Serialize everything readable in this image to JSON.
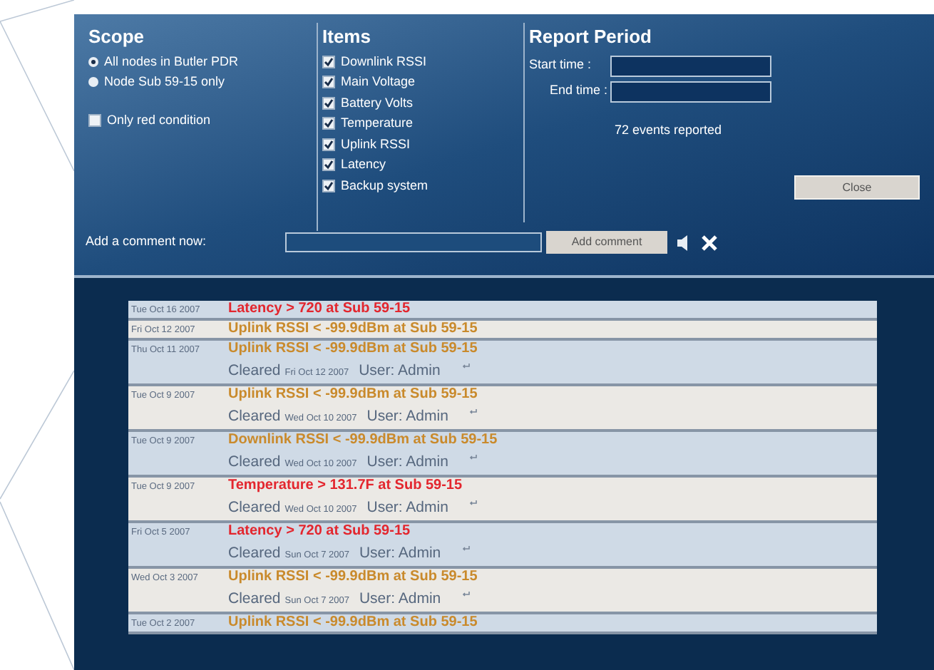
{
  "scope": {
    "title": "Scope",
    "options": [
      {
        "label": "All nodes in Butler PDR",
        "selected": true
      },
      {
        "label": "Node Sub 59-15 only",
        "selected": false
      }
    ],
    "filter": {
      "label": "Only red condition",
      "checked": false
    }
  },
  "items": {
    "title": "Items",
    "options": [
      {
        "label": "Downlink RSSI",
        "checked": true
      },
      {
        "label": "Main Voltage",
        "checked": true
      },
      {
        "label": "Battery Volts",
        "checked": true
      },
      {
        "label": "Temperature",
        "checked": true
      },
      {
        "label": "Uplink RSSI",
        "checked": true
      },
      {
        "label": "Latency",
        "checked": true
      },
      {
        "label": "Backup system",
        "checked": true
      }
    ]
  },
  "report_period": {
    "title": "Report Period",
    "start_label": "Start time :",
    "end_label": "End time :",
    "summary": "72 events reported"
  },
  "close_button": "Close",
  "comment": {
    "label": "Add a comment now:",
    "button": "Add comment"
  },
  "events": [
    {
      "date": "Tue Oct 16 2007",
      "message": "Latency > 720 at Sub 59-15",
      "kind": "red"
    },
    {
      "date": "Fri Oct 12 2007",
      "message": "Uplink RSSI < -99.9dBm at Sub 59-15",
      "kind": "orange"
    },
    {
      "date": "Thu Oct 11 2007",
      "message": "Uplink RSSI < -99.9dBm at Sub 59-15",
      "kind": "orange",
      "cleared": {
        "label": "Cleared",
        "date": "Fri Oct 12 2007",
        "user": "User: Admin"
      }
    },
    {
      "date": "Tue Oct 9 2007",
      "message": "Uplink RSSI < -99.9dBm at Sub 59-15",
      "kind": "orange",
      "cleared": {
        "label": "Cleared",
        "date": "Wed Oct 10 2007",
        "user": "User: Admin"
      }
    },
    {
      "date": "Tue Oct 9 2007",
      "message": "Downlink RSSI < -99.9dBm at Sub 59-15",
      "kind": "orange",
      "cleared": {
        "label": "Cleared",
        "date": "Wed Oct 10 2007",
        "user": "User: Admin"
      }
    },
    {
      "date": "Tue Oct 9 2007",
      "message": "Temperature > 131.7F at Sub 59-15",
      "kind": "red",
      "cleared": {
        "label": "Cleared",
        "date": "Wed Oct 10 2007",
        "user": "User: Admin"
      }
    },
    {
      "date": "Fri Oct 5 2007",
      "message": "Latency > 720 at Sub 59-15",
      "kind": "red",
      "cleared": {
        "label": "Cleared",
        "date": "Sun Oct 7 2007",
        "user": "User: Admin"
      }
    },
    {
      "date": "Wed Oct 3 2007",
      "message": "Uplink RSSI < -99.9dBm at Sub 59-15",
      "kind": "orange",
      "cleared": {
        "label": "Cleared",
        "date": "Sun Oct 7 2007",
        "user": "User: Admin"
      }
    },
    {
      "date": "Tue Oct 2 2007",
      "message": "Uplink RSSI < -99.9dBm at Sub 59-15",
      "kind": "orange"
    }
  ]
}
